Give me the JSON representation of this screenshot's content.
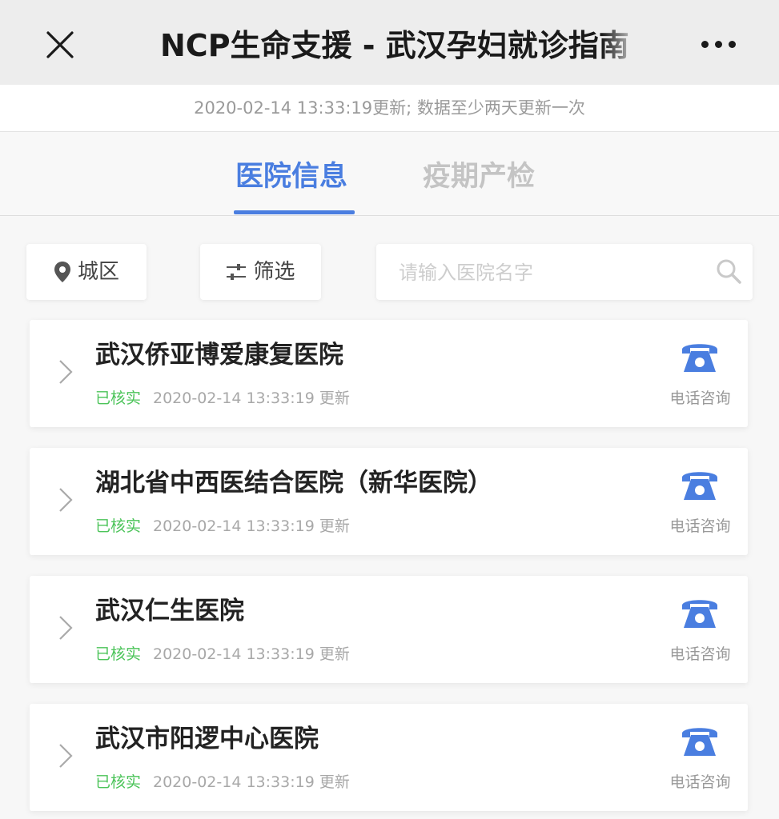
{
  "header": {
    "title": "NCP生命支援 - 武汉孕妇就诊指南",
    "update_notice": "2020-02-14 13:33:19更新; 数据至少两天更新一次"
  },
  "tabs": [
    {
      "label": "医院信息",
      "active": true
    },
    {
      "label": "疫期产检",
      "active": false
    }
  ],
  "filters": {
    "district_label": "城区",
    "filter_label": "筛选",
    "search_placeholder": "请输入医院名字"
  },
  "hospitals": [
    {
      "name": "武汉侨亚博爱康复医院",
      "status": "已核实",
      "updated": "2020-02-14 13:33:19 更新",
      "action": "电话咨询"
    },
    {
      "name": "湖北省中西医结合医院（新华医院）",
      "status": "已核实",
      "updated": "2020-02-14 13:33:19 更新",
      "action": "电话咨询"
    },
    {
      "name": "武汉仁生医院",
      "status": "已核实",
      "updated": "2020-02-14 13:33:19 更新",
      "action": "电话咨询"
    },
    {
      "name": "武汉市阳逻中心医院",
      "status": "已核实",
      "updated": "2020-02-14 13:33:19 更新",
      "action": "电话咨询"
    }
  ],
  "colors": {
    "accent": "#4a7ee0",
    "verified": "#4cc45a",
    "tab_inactive": "#c4c4c4"
  },
  "icons": [
    "close-icon",
    "more-icon",
    "location-pin-icon",
    "sliders-icon",
    "search-icon",
    "chevron-right-icon",
    "phone-icon"
  ]
}
